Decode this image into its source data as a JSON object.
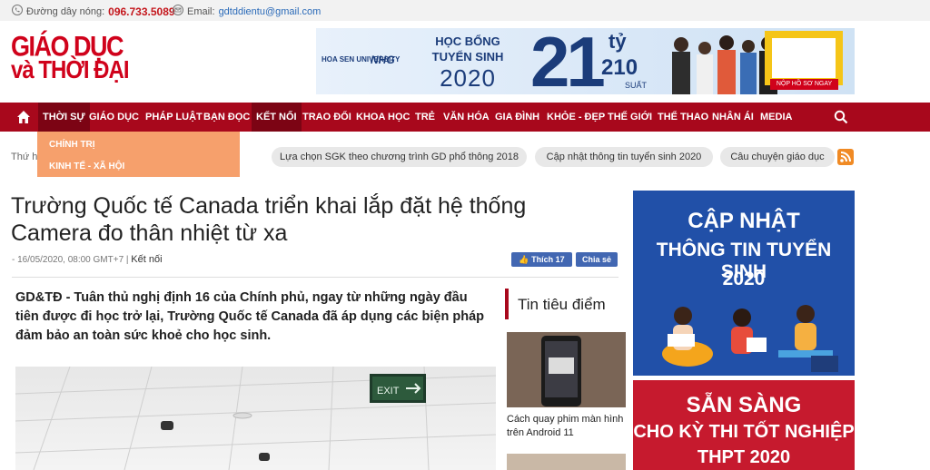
{
  "topbar": {
    "hotline_label": "Đường dây nóng:",
    "hotline_number": "096.733.5089",
    "email_label": "Email:",
    "email_value": "gdtddientu@gmail.com"
  },
  "logo": {
    "line1": "GIÁO DỤC",
    "line2": "và THỜI ĐẠI"
  },
  "banner": {
    "university": "HOA SEN UNIVERSITY",
    "brand": "NHG",
    "headline": "HỌC BỔNG TUYỂN SINH",
    "year": "2020",
    "amount": "21",
    "unit": "tỷ",
    "slots": "210",
    "slots_unit": "SUẤT",
    "cta": "NỘP HỒ SƠ NGAY"
  },
  "nav": {
    "items": [
      "THỜI SỰ",
      "GIÁO DỤC",
      "PHÁP LUẬT",
      "BẠN ĐỌC",
      "KẾT NỐI",
      "TRAO ĐỔI",
      "KHOA HỌC",
      "TRẺ",
      "VĂN HÓA",
      "GIA ĐÌNH",
      "KHỎE - ĐẸP",
      "THẾ GIỚI",
      "THỂ THAO",
      "NHÂN ÁI",
      "MEDIA"
    ],
    "dropdown": [
      "CHÍNH TRỊ",
      "KINH TẾ - XÃ HỘI"
    ]
  },
  "breadcrumb": "Thứ h",
  "tags": [
    "Lựa chọn SGK theo chương trình GD phổ thông 2018",
    "Cập nhật thông tin tuyển sinh 2020",
    "Câu chuyện giáo dục"
  ],
  "article": {
    "title": "Trường Quốc tế Canada triển khai lắp đặt hệ thống Camera đo thân nhiệt từ xa",
    "date": "- 16/05/2020, 08:00 GMT+7 |",
    "category": "Kết nối",
    "like_label": "Thích 17",
    "share_label": "Chia sẻ",
    "sapo_lead": "GD&TĐ",
    "sapo": "GD&TĐ - Tuân thủ nghị định 16 của Chính phủ, ngay từ những ngày đầu tiên được đi học trở lại, Trường Quốc tế Canada đã áp dụng các biện pháp đảm bảo an toàn sức khoẻ cho học sinh.",
    "exit_sign": "EXIT"
  },
  "sidebar": {
    "heading": "Tin tiêu điểm",
    "story_caption": "Cách quay phim màn hình trên Android 11"
  },
  "ads": {
    "ad1": [
      "CẬP NHẬT",
      "THÔNG TIN TUYỂN SINH",
      "2020"
    ],
    "ad2": [
      "SẴN SÀNG",
      "CHO KỲ THI TỐT NGHIỆP",
      "THPT 2020"
    ]
  },
  "colors": {
    "brand_red": "#a8081c",
    "dropdown_orange": "#f6a06c",
    "ad_blue": "#2150a8",
    "ad_red": "#c61a2e"
  }
}
